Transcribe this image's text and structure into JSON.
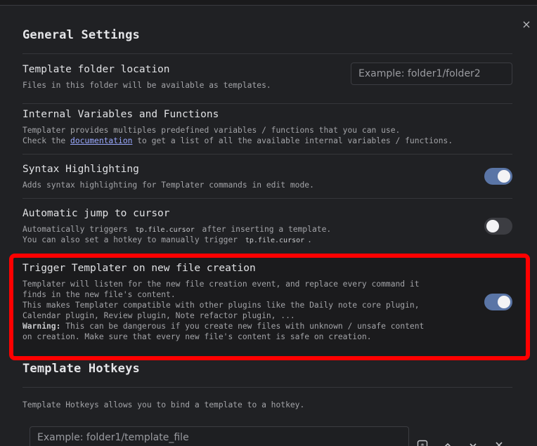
{
  "modal": {
    "close_label": "×"
  },
  "general": {
    "heading": "General Settings",
    "template_folder": {
      "name": "Template folder location",
      "desc": "Files in this folder will be available as templates.",
      "placeholder": "Example: folder1/folder2"
    },
    "internal_vars": {
      "name": "Internal Variables and Functions",
      "desc_line1": "Templater provides multiples predefined variables / functions that you can use.",
      "desc_line2_prefix": "Check the ",
      "desc_link": "documentation",
      "desc_line2_suffix": " to get a list of all the available internal variables / functions."
    },
    "syntax_highlighting": {
      "name": "Syntax Highlighting",
      "desc": "Adds syntax highlighting for Templater commands in edit mode.",
      "enabled": true
    },
    "auto_jump": {
      "name": "Automatic jump to cursor",
      "desc_line1_prefix": "Automatically triggers ",
      "desc_code": "tp.file.cursor",
      "desc_line1_suffix": " after inserting a template.",
      "desc_line2_prefix": "You can also set a hotkey to manually trigger ",
      "desc_line2_suffix": ".",
      "enabled": false
    },
    "trigger_on_create": {
      "name": "Trigger Templater on new file creation",
      "desc_line1": "Templater will listen for the new file creation event, and replace every command it",
      "desc_line2": "finds in the new file's content.",
      "desc_line3": "This makes Templater compatible with other plugins like the Daily note core plugin,",
      "desc_line4": "Calendar plugin, Review plugin, Note refactor plugin, ...",
      "warning_label": "Warning:",
      "warning_line1": " This can be dangerous if you create new files with unknown / unsafe content",
      "warning_line2": "on creation. Make sure that every new file's content is safe on creation.",
      "enabled": true
    }
  },
  "hotkeys": {
    "heading": "Template Hotkeys",
    "desc": "Template Hotkeys allows you to bind a template to a hotkey.",
    "input_placeholder": "Example: folder1/template_file",
    "icons": [
      "hotkey-icon",
      "chevron-up-icon",
      "chevron-down-icon",
      "close-icon"
    ]
  },
  "colors": {
    "accent": "#5a75a6",
    "highlight_border": "#ff0000",
    "background": "#202124"
  }
}
